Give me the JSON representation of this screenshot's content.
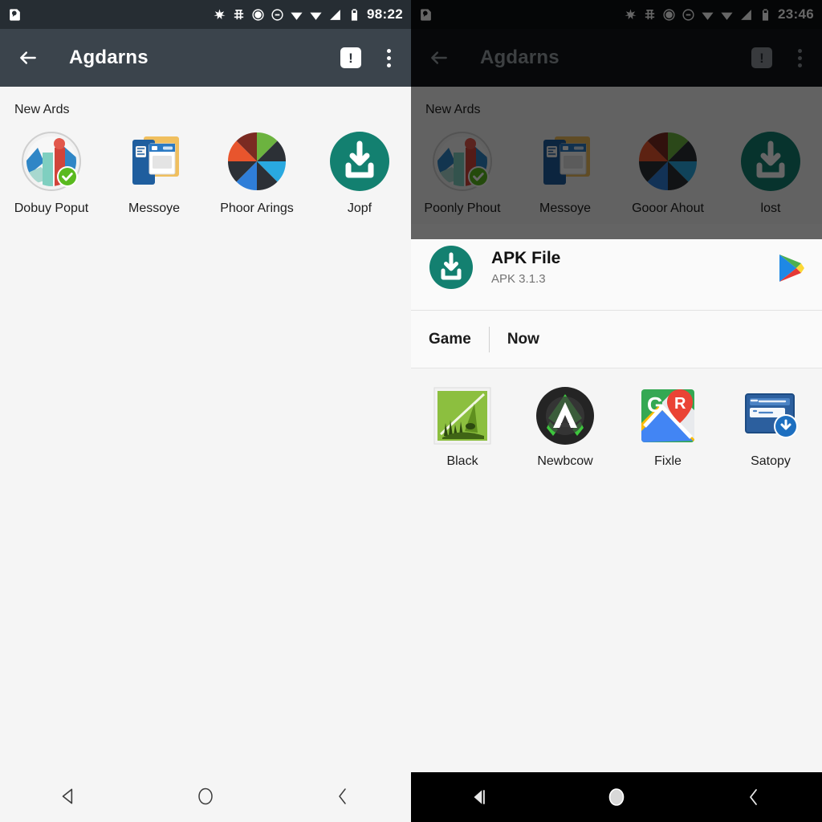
{
  "left_panel": {
    "status_bar": {
      "clock": "98:22",
      "icons": [
        "message-icon",
        "asterisk-icon",
        "hash-icon",
        "alarm-icon",
        "dnd-icon",
        "wifi-icon",
        "wifi-2-icon",
        "signal-icon",
        "battery-icon"
      ]
    },
    "app_bar": {
      "title": "Agdarns",
      "back_icon": "back-arrow-icon",
      "alert_label": "!",
      "overflow_icon": "kebab-menu-icon"
    },
    "section": {
      "label": "New Ards"
    },
    "apps": [
      {
        "label": "Dobuy Poput",
        "icon": "chart-badge-icon"
      },
      {
        "label": "Messoye",
        "icon": "windows-stack-icon"
      },
      {
        "label": "Phoor Arings",
        "icon": "pie-wheel-icon"
      },
      {
        "label": "Jopf",
        "icon": "download-circle-icon"
      }
    ],
    "nav_bar": {
      "back": "nav-back-triangle-icon",
      "home": "nav-home-circle-icon",
      "recents": "nav-recents-chevron-icon"
    }
  },
  "right_panel": {
    "status_bar": {
      "clock": "23:46",
      "icons": [
        "message-icon",
        "asterisk-icon",
        "hash-icon",
        "alarm-icon",
        "dnd-icon",
        "wifi-icon",
        "wifi-2-icon",
        "signal-icon",
        "battery-icon"
      ]
    },
    "app_bar": {
      "title": "Agdarns",
      "back_icon": "back-arrow-icon",
      "alert_label": "!",
      "overflow_icon": "kebab-menu-icon"
    },
    "section": {
      "label": "New Ards"
    },
    "apps": [
      {
        "label": "Poonly Phout",
        "icon": "chart-badge-icon"
      },
      {
        "label": "Messoye",
        "icon": "windows-stack-icon"
      },
      {
        "label": "Gooor Ahout",
        "icon": "pie-wheel-icon"
      },
      {
        "label": "lost",
        "icon": "download-circle-icon"
      }
    ],
    "apk_row": {
      "title": "APK File",
      "subtitle": "APK 3.1.3",
      "icon": "download-circle-icon",
      "store_icon": "play-store-icon"
    },
    "tabs": [
      {
        "label": "Game"
      },
      {
        "label": "Now"
      }
    ],
    "chooser_apps": [
      {
        "label": "Black",
        "icon": "green-landscape-icon"
      },
      {
        "label": "Newbcow",
        "icon": "dark-circle-arrow-icon"
      },
      {
        "label": "Fixle",
        "icon": "maps-pin-icon"
      },
      {
        "label": "Satopy",
        "icon": "blue-window-download-icon"
      }
    ],
    "nav_bar": {
      "back": "nav-back-triangle-icon",
      "home": "nav-home-circle-icon",
      "recents": "nav-recents-chevron-icon"
    }
  },
  "colors": {
    "appbar_left": "#3b444c",
    "appbar_right": "#12161a",
    "statusbar_left": "#262d33",
    "statusbar_right": "#0d0f12",
    "content_bg": "#f5f5f5",
    "teal_accent": "#138070",
    "scrim": "rgba(0,0,0,0.6)"
  }
}
